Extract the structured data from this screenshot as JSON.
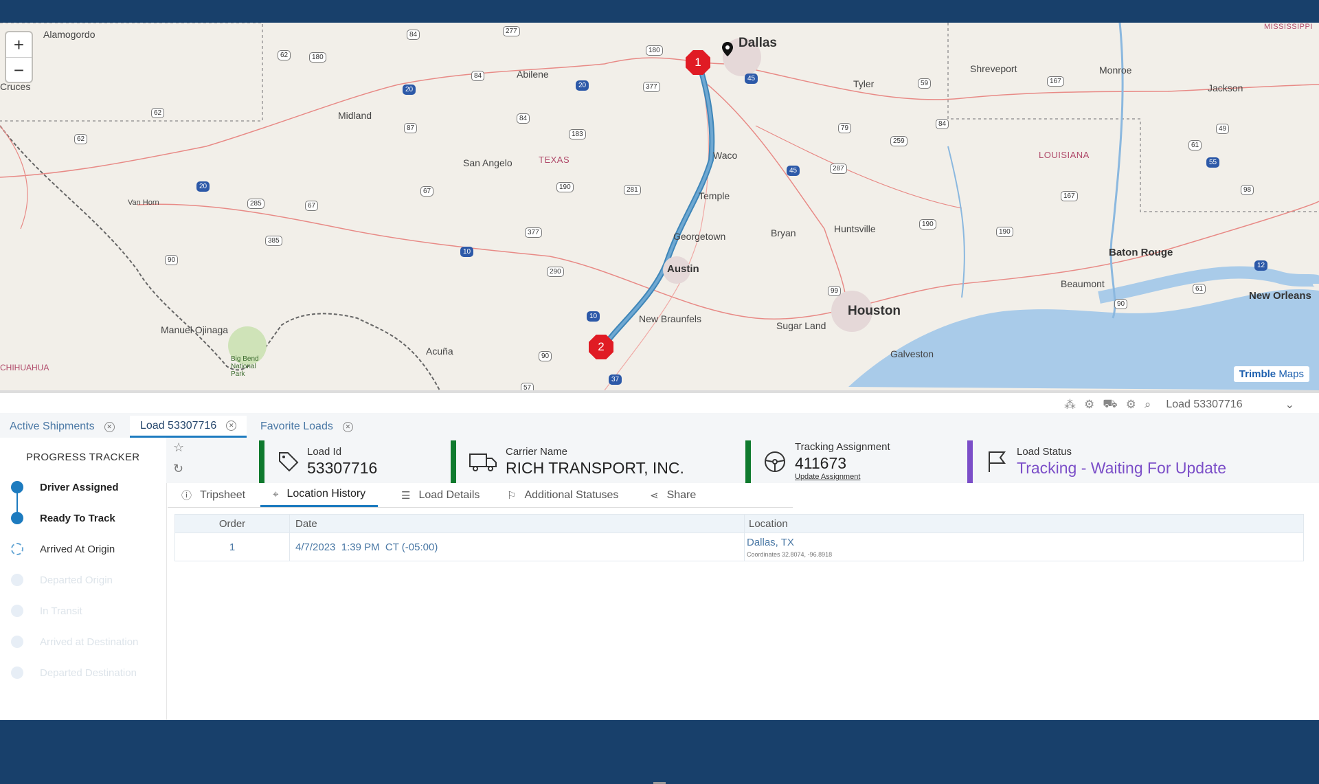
{
  "map": {
    "zoom_in": "+",
    "zoom_out": "−",
    "attribution_brand": "Trimble",
    "attribution_product": "Maps",
    "cities": [
      {
        "name": "Alamogordo",
        "cls": ""
      },
      {
        "name": "Dallas",
        "cls": "big"
      },
      {
        "name": "Shreveport",
        "cls": ""
      },
      {
        "name": "Monroe",
        "cls": ""
      },
      {
        "name": "Jackson",
        "cls": ""
      },
      {
        "name": "Abilene",
        "cls": ""
      },
      {
        "name": "Midland",
        "cls": ""
      },
      {
        "name": "Tyler",
        "cls": ""
      },
      {
        "name": "Cruces",
        "cls": ""
      },
      {
        "name": "San Angelo",
        "cls": ""
      },
      {
        "name": "Waco",
        "cls": ""
      },
      {
        "name": "Temple",
        "cls": ""
      },
      {
        "name": "Van Horn",
        "cls": ""
      },
      {
        "name": "Georgetown",
        "cls": ""
      },
      {
        "name": "Bryan",
        "cls": ""
      },
      {
        "name": "Huntsville",
        "cls": ""
      },
      {
        "name": "Austin",
        "cls": "mid"
      },
      {
        "name": "Baton Rouge",
        "cls": "mid"
      },
      {
        "name": "Beaumont",
        "cls": ""
      },
      {
        "name": "New Orleans",
        "cls": "mid"
      },
      {
        "name": "New Braunfels",
        "cls": ""
      },
      {
        "name": "Sugar Land",
        "cls": ""
      },
      {
        "name": "Houston",
        "cls": "big"
      },
      {
        "name": "Manuel Ojinaga",
        "cls": ""
      },
      {
        "name": "Acuña",
        "cls": ""
      },
      {
        "name": "Galveston",
        "cls": ""
      },
      {
        "name": "Big Bend National Park",
        "cls": ""
      },
      {
        "name": "CHIHUAHUA",
        "cls": ""
      }
    ],
    "states": [
      "TEXAS",
      "LOUISIANA",
      "MISSISSIPPI"
    ],
    "markers": [
      "1",
      "2"
    ]
  },
  "toolbar": {
    "load_select": "Load 53307716"
  },
  "tabs": [
    {
      "label": "Active Shipments"
    },
    {
      "label": "Load 53307716"
    },
    {
      "label": "Favorite Loads"
    }
  ],
  "progress": {
    "title": "PROGRESS TRACKER",
    "steps": [
      {
        "label": "Driver Assigned",
        "state": "done"
      },
      {
        "label": "Ready To Track",
        "state": "done"
      },
      {
        "label": "Arrived At Origin",
        "state": "pending"
      },
      {
        "label": "Departed Origin",
        "state": "future"
      },
      {
        "label": "In Transit",
        "state": "future"
      },
      {
        "label": "Arrived at Destination",
        "state": "future"
      },
      {
        "label": "Departed Destination",
        "state": "future"
      }
    ]
  },
  "cards": {
    "load_id": {
      "label": "Load Id",
      "value": "53307716"
    },
    "carrier": {
      "label": "Carrier Name",
      "value": "RICH TRANSPORT, INC."
    },
    "tracking": {
      "label": "Tracking Assignment",
      "value": "411673",
      "link": "Update Assignment"
    },
    "status": {
      "label": "Load Status",
      "value": "Tracking - Waiting For Update"
    }
  },
  "subtabs": [
    {
      "label": "Tripsheet"
    },
    {
      "label": "Location History"
    },
    {
      "label": "Load Details"
    },
    {
      "label": "Additional Statuses"
    },
    {
      "label": "Share"
    }
  ],
  "table": {
    "headers": [
      "Order",
      "Date",
      "Location"
    ],
    "rows": [
      {
        "order": "1",
        "date": "4/7/2023  1:39 PM  CT (-05:00)",
        "location": "Dallas, TX",
        "coords": "Coordinates 32.8074,  -96.8918"
      }
    ]
  },
  "colors": {
    "nav": "#18406b",
    "accent": "#1d7bbf",
    "card_border": "#0f7a2e",
    "status": "#7b4ec8",
    "marker": "#e01b24"
  }
}
